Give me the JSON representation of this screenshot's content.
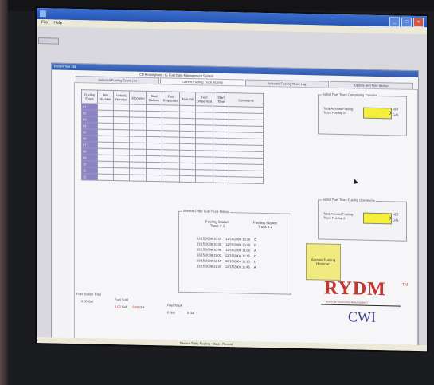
{
  "window": {
    "title": "",
    "menu": [
      "File",
      "Help"
    ]
  },
  "child_window": {
    "title": "RYDM Test 188",
    "header": "CD Birmingham - G. Fuel Data Management System"
  },
  "tabs": [
    {
      "label": "Selected Fueling Event List"
    },
    {
      "label": "Current Fueling Truck Activity"
    },
    {
      "label": "Selected Fueling Truck Log"
    },
    {
      "label": "Update and Find Sticker"
    }
  ],
  "table": {
    "headers": [
      "Fueling Event",
      "Unit Number",
      "Vehicle Number",
      "Odometer",
      "Total Gallons",
      "Fuel Requested",
      "Fuel Fill",
      "Fuel Dispensed",
      "Start Time",
      "Comments"
    ],
    "rows": [
      [
        "01",
        "",
        "",
        "",
        "",
        "",
        "",
        "",
        "",
        ""
      ],
      [
        "02",
        "",
        "",
        "",
        "",
        "",
        "",
        "",
        "",
        ""
      ],
      [
        "03",
        "",
        "",
        "",
        "",
        "",
        "",
        "",
        "",
        ""
      ],
      [
        "04",
        "",
        "",
        "",
        "",
        "",
        "",
        "",
        "",
        ""
      ],
      [
        "05",
        "",
        "",
        "",
        "",
        "",
        "",
        "",
        "",
        ""
      ],
      [
        "06",
        "",
        "",
        "",
        "",
        "",
        "",
        "",
        "",
        ""
      ],
      [
        "07",
        "",
        "",
        "",
        "",
        "",
        "",
        "",
        "",
        ""
      ],
      [
        "08",
        "",
        "",
        "",
        "",
        "",
        "",
        "",
        "",
        ""
      ],
      [
        "09",
        "",
        "",
        "",
        "",
        "",
        "",
        "",
        "",
        ""
      ],
      [
        "10",
        "",
        "",
        "",
        "",
        "",
        "",
        "",
        "",
        ""
      ],
      [
        "11",
        "",
        "",
        "",
        "",
        "",
        "",
        "",
        "",
        ""
      ],
      [
        "12",
        "",
        "",
        "",
        "",
        "",
        "",
        "",
        "",
        ""
      ]
    ]
  },
  "fueling_top": {
    "group_label": "Select Fuel Truck Completing Transfer",
    "field_label": "Total Amount Fueling Truck Fueling #1",
    "value": "0",
    "unit1": "NET",
    "unit2": "GAL"
  },
  "fueling_bottom": {
    "group_label": "Select Fuel Truck Fueling Operations",
    "field_label": "Total Amount Fueling Truck Fueling #1",
    "value": "0",
    "unit1": "NET",
    "unit2": "GAL"
  },
  "action_button": {
    "label": "Access Fueling Historian"
  },
  "logo": {
    "name": "RYDM",
    "tm": "TM",
    "tagline": "RANSOM YOUR DATA MANAGEMENT",
    "sub": "CWI"
  },
  "inner_panel": {
    "title": "Service Order Fuel Truck History",
    "col1": "Fueling Station Truck # 1",
    "col2": "Fueling Station Truck # 2",
    "rows": [
      {
        "a": "12/15/2009 10:15",
        "b": "12/15/2009 10:30",
        "c": "C"
      },
      {
        "a": "12/15/2009 10:30",
        "b": "12/15/2009 10:45",
        "c": "D"
      },
      {
        "a": "12/15/2009 10:45",
        "b": "12/15/2009 11:00",
        "c": "A"
      },
      {
        "a": "12/15/2009 11:00",
        "b": "12/15/2009 11:15",
        "c": "C"
      },
      {
        "a": "12/15/2009 11:15",
        "b": "12/15/2009 11:30",
        "c": "D"
      },
      {
        "a": "12/15/2009 11:30",
        "b": "12/15/2009 11:45",
        "c": "A"
      }
    ]
  },
  "bottom": {
    "group1_label": "Fuel Station Total",
    "group1_value": "0.00 Gal",
    "group2_label": "Fuel Sold",
    "group2_value_a": "0.00",
    "group2_unit_a": "Gal",
    "group2_value_b": "0.00",
    "group2_unit_b": "Gal",
    "group3_label": "Fuel Truck",
    "group3_value_a": "0",
    "group3_unit_a": "Gal",
    "group3_value_b": "0",
    "group3_unit_b": "Gal"
  },
  "status": {
    "text": "Record Table Fueling - Data - Record"
  }
}
